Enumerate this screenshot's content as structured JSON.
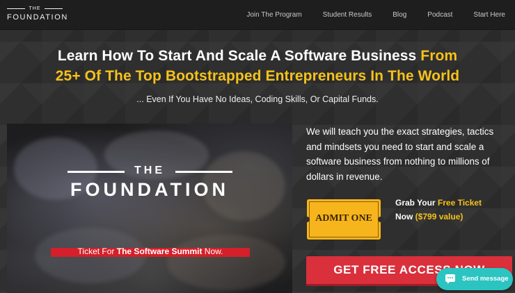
{
  "nav": {
    "logo": {
      "the": "THE",
      "word": "FOUNDATION"
    },
    "links": [
      "Join The Program",
      "Student Results",
      "Blog",
      "Podcast",
      "Start Here"
    ]
  },
  "hero": {
    "headline_white": "Learn How To Start And Scale A Software Business",
    "headline_accent_1": "From",
    "headline_accent_2": "25+ Of The Top Bootstrapped Entrepreneurs In The World",
    "subline": "... Even If You Have No Ideas, Coding Skills, Or Capital Funds."
  },
  "video": {
    "the": "THE",
    "word": "FOUNDATION",
    "ticket_prefix": "Ticket For ",
    "ticket_bold": "The Software Summit",
    "ticket_suffix": " Now."
  },
  "pitch": {
    "text": "We will teach you the exact strategies, tactics and mindsets you need to start and scale a software business from nothing to millions of dollars in revenue."
  },
  "ticket": {
    "admit_label": "ADMIT ONE",
    "grab_1": "Grab Your ",
    "grab_accent": "Free Ticket",
    "grab_2": "Now ",
    "grab_value": "($799 value)"
  },
  "cta": {
    "label": "GET FREE ACCESS NOW"
  },
  "chat": {
    "label": "Send message",
    "icon": "chat-bubble-icon"
  },
  "colors": {
    "accent": "#f6c21b",
    "cta_red": "#d9303c",
    "chat_teal": "#2cc4c1",
    "nav_bg": "#1e1e1e"
  }
}
